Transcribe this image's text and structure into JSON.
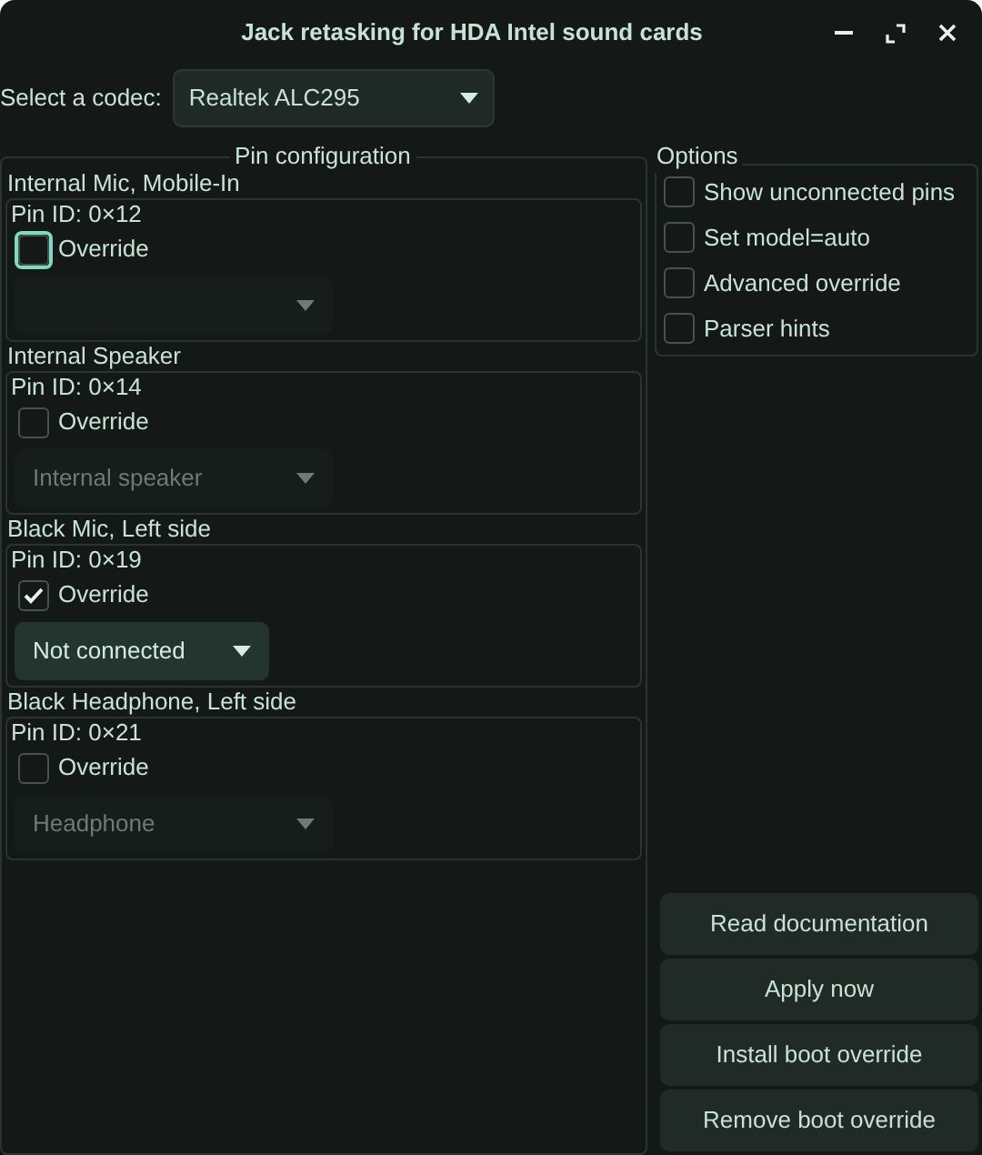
{
  "window": {
    "title": "Jack retasking for HDA Intel sound cards"
  },
  "codec": {
    "label": "Select a codec:",
    "value": "Realtek ALC295"
  },
  "pin_configuration": {
    "title": "Pin configuration",
    "pins": [
      {
        "name": "Internal Mic, Mobile-In",
        "pin_id": "Pin ID: 0×12",
        "override": {
          "label": "Override",
          "checked": false,
          "focused": true
        },
        "dropdown": {
          "disabled": true
        }
      },
      {
        "name": "Internal Speaker",
        "pin_id": "Pin ID: 0×14",
        "override": {
          "label": "Override",
          "checked": false,
          "focused": false
        },
        "dropdown": {
          "value": "Internal speaker",
          "disabled": true
        }
      },
      {
        "name": "Black Mic, Left side",
        "pin_id": "Pin ID: 0×19",
        "override": {
          "label": "Override",
          "checked": true,
          "focused": false
        },
        "dropdown": {
          "value": "Not connected",
          "disabled": false
        }
      },
      {
        "name": "Black Headphone, Left side",
        "pin_id": "Pin ID: 0×21",
        "override": {
          "label": "Override",
          "checked": false,
          "focused": false
        },
        "dropdown": {
          "value": "Headphone",
          "disabled": true
        }
      }
    ]
  },
  "options": {
    "title": "Options",
    "items": [
      {
        "label": "Show unconnected pins",
        "checked": false
      },
      {
        "label": "Set model=auto",
        "checked": false
      },
      {
        "label": "Advanced override",
        "checked": false
      },
      {
        "label": "Parser hints",
        "checked": false
      }
    ]
  },
  "buttons": [
    "Read documentation",
    "Apply now",
    "Install boot override",
    "Remove boot override"
  ]
}
